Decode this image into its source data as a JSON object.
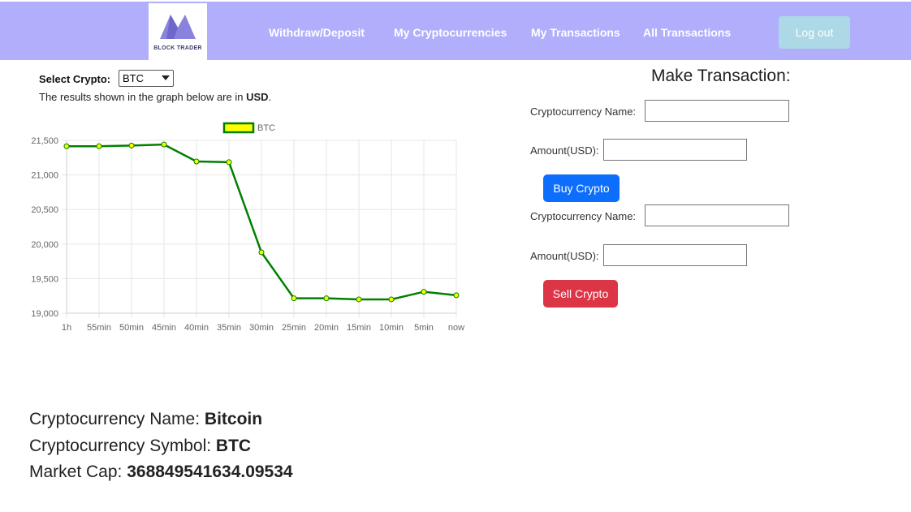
{
  "header": {
    "logo_text": "BLOCK TRADER",
    "nav": [
      "Withdraw/Deposit",
      "My Cryptocurrencies",
      "My Transactions",
      "All Transactions"
    ],
    "logout_label": "Log out"
  },
  "selector": {
    "label": "Select Crypto:",
    "value": "BTC",
    "note_prefix": "The results shown in the graph below are in ",
    "currency": "USD",
    "note_suffix": "."
  },
  "transaction": {
    "title": "Make Transaction:",
    "name_label": "Cryptocurrency Name:",
    "amount_label": "Amount(USD):",
    "buy_label": "Buy Crypto",
    "sell_label": "Sell Crypto"
  },
  "info": {
    "name_label": "Cryptocurrency Name: ",
    "name_value": "Bitcoin",
    "symbol_label": "Cryptocurrency Symbol: ",
    "symbol_value": "BTC",
    "cap_label": "Market Cap: ",
    "cap_value": "368849541634.09534"
  },
  "chart_data": {
    "type": "line",
    "categories": [
      "1h",
      "55min",
      "50min",
      "45min",
      "40min",
      "35min",
      "30min",
      "25min",
      "20min",
      "15min",
      "10min",
      "5min",
      "now"
    ],
    "series": [
      {
        "name": "BTC",
        "values": [
          21415,
          21415,
          21425,
          21440,
          21195,
          21185,
          19880,
          19215,
          19215,
          19200,
          19200,
          19310,
          19260
        ]
      }
    ],
    "ylim": [
      19000,
      21500
    ],
    "yticks": [
      19000,
      19500,
      20000,
      20500,
      21000,
      21500
    ],
    "ytick_labels": [
      "19,000",
      "19,500",
      "20,000",
      "20,500",
      "21,000",
      "21,500"
    ],
    "grid": true,
    "legend": "top",
    "colors": {
      "line": "#008000",
      "point_fill": "#ffff00",
      "point_stroke": "#008000"
    }
  },
  "colors": {
    "navbar": "#b1aefc",
    "logout": "#add8e6",
    "buy": "#0d6efd",
    "sell": "#dc3545"
  }
}
